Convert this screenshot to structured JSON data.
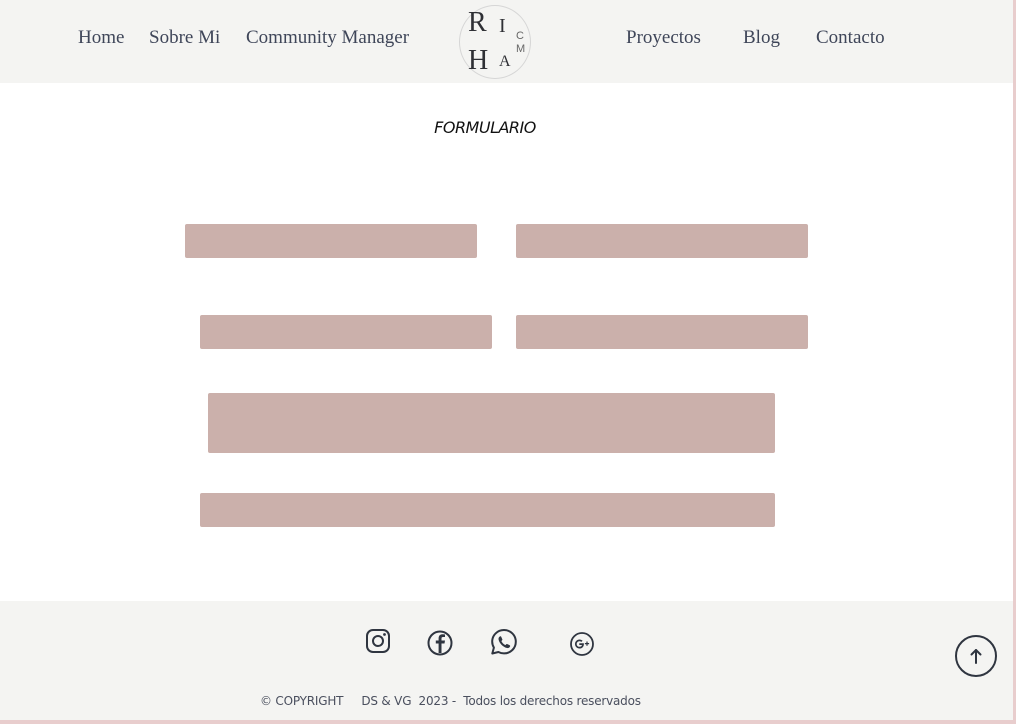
{
  "nav": {
    "left": [
      "Home",
      "Sobre Mi",
      "Community Manager"
    ],
    "right": [
      "Proyectos",
      "Blog",
      "Contacto"
    ]
  },
  "logo": {
    "letters": [
      "R",
      "I",
      "H",
      "A",
      "C",
      "M"
    ]
  },
  "form": {
    "title": "FORMULARIO"
  },
  "footer": {
    "social_icons": [
      "instagram-icon",
      "facebook-icon",
      "whatsapp-icon",
      "google-plus-icon"
    ],
    "copyright": "© COPYRIGHT     DS & VG  2023 -  Todos los derechos reservados",
    "back_to_top_icon": "arrow-up-icon"
  },
  "colors": {
    "header_bg": "#f4f4f2",
    "field_bg": "#cbb0ab",
    "nav_text": "#3f4659",
    "frame_accent": "#e8cdcd"
  }
}
